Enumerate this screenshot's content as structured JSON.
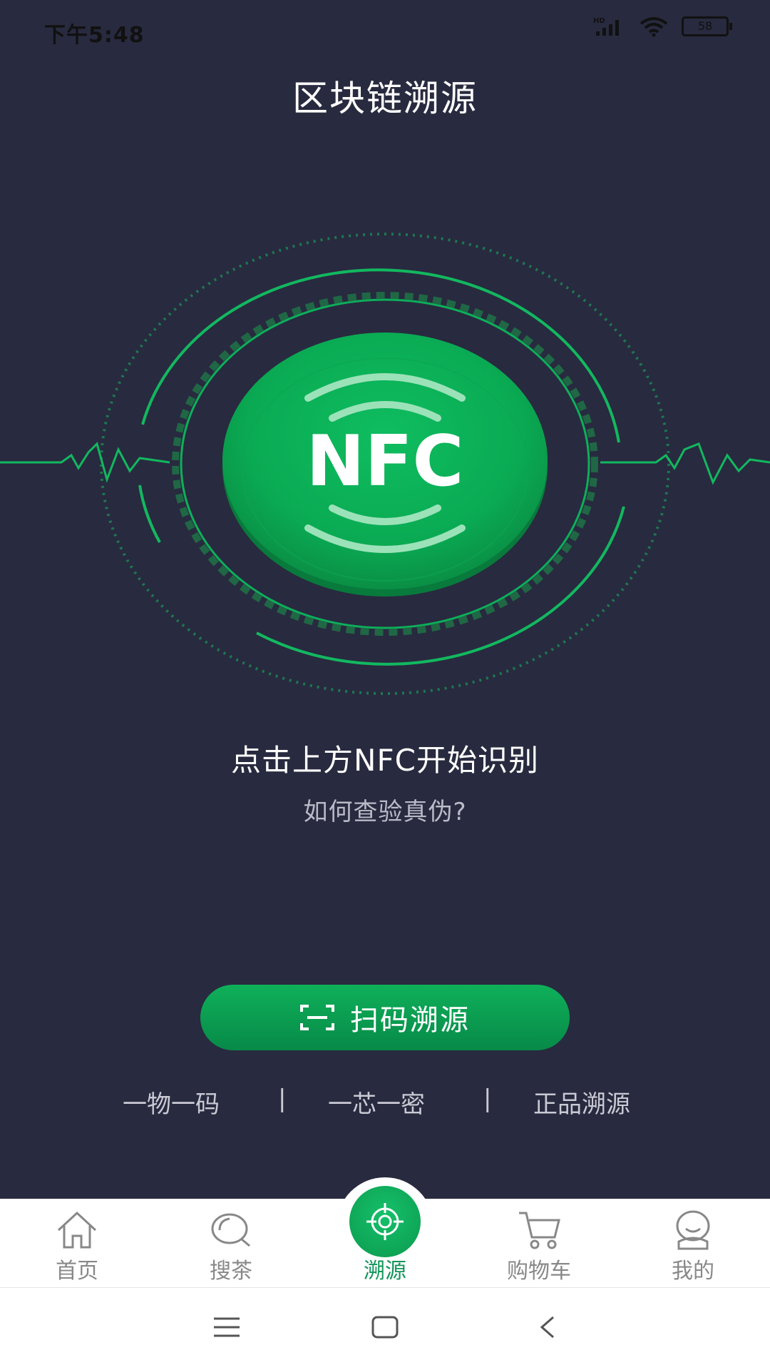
{
  "status_bar": {
    "time": "下午5:48",
    "battery_level": "58",
    "signal_label": "HD"
  },
  "header": {
    "title": "区块链溯源"
  },
  "nfc": {
    "label": "NFC"
  },
  "main": {
    "prompt": "点击上方NFC开始识别",
    "help_link": "如何查验真伪?",
    "scan_button": "扫码溯源",
    "features": [
      "一物一码",
      "|",
      "一芯一密",
      "|",
      "正品溯源"
    ]
  },
  "tabs": [
    {
      "label": "首页",
      "icon": "home-icon"
    },
    {
      "label": "搜茶",
      "icon": "search-icon"
    },
    {
      "label": "溯源",
      "icon": "target-icon",
      "active": true
    },
    {
      "label": "购物车",
      "icon": "cart-icon"
    },
    {
      "label": "我的",
      "icon": "profile-icon"
    }
  ],
  "colors": {
    "background": "#282A3F",
    "accent": "#0DAF5A",
    "active_tab": "#12955A"
  }
}
